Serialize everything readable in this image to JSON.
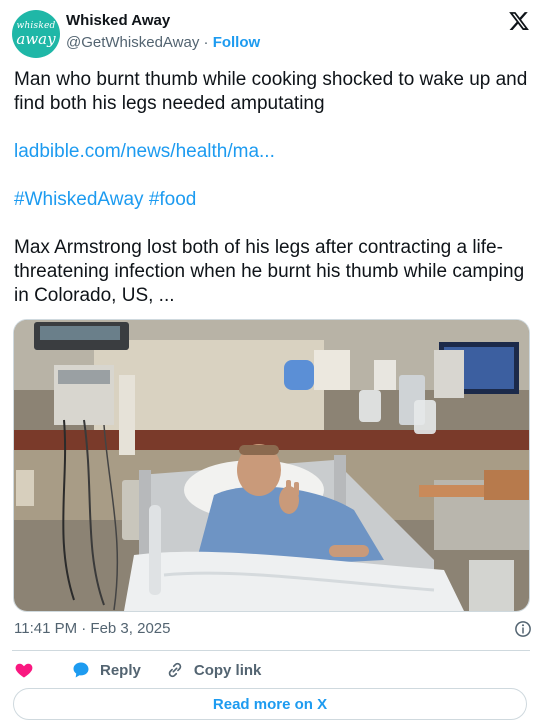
{
  "header": {
    "avatar_line1": "whisked",
    "avatar_line2": "away",
    "display_name": "Whisked Away",
    "handle": "@GetWhiskedAway",
    "separator": "·",
    "follow_label": "Follow"
  },
  "tweet": {
    "headline": "Man who burnt thumb while cooking shocked to wake up and find both his legs needed amputating",
    "link_text": "ladbible.com/news/health/ma...",
    "hashtags": [
      "#WhiskedAway",
      "#food"
    ],
    "summary": "Max Armstrong lost both of his legs after contracting a life-threatening infection when he burnt his thumb while camping in Colorado, US, ..."
  },
  "media": {
    "icon": "hospital-photo"
  },
  "meta": {
    "timestamp": "11:41 PM · Feb 3, 2025"
  },
  "actions": {
    "reply_label": "Reply",
    "copy_link_label": "Copy link"
  },
  "read_more_label": "Read more on X",
  "colors": {
    "accent": "#1d9bf0",
    "like": "#f91880",
    "avatar": "#1fb7a7",
    "muted": "#536471"
  }
}
